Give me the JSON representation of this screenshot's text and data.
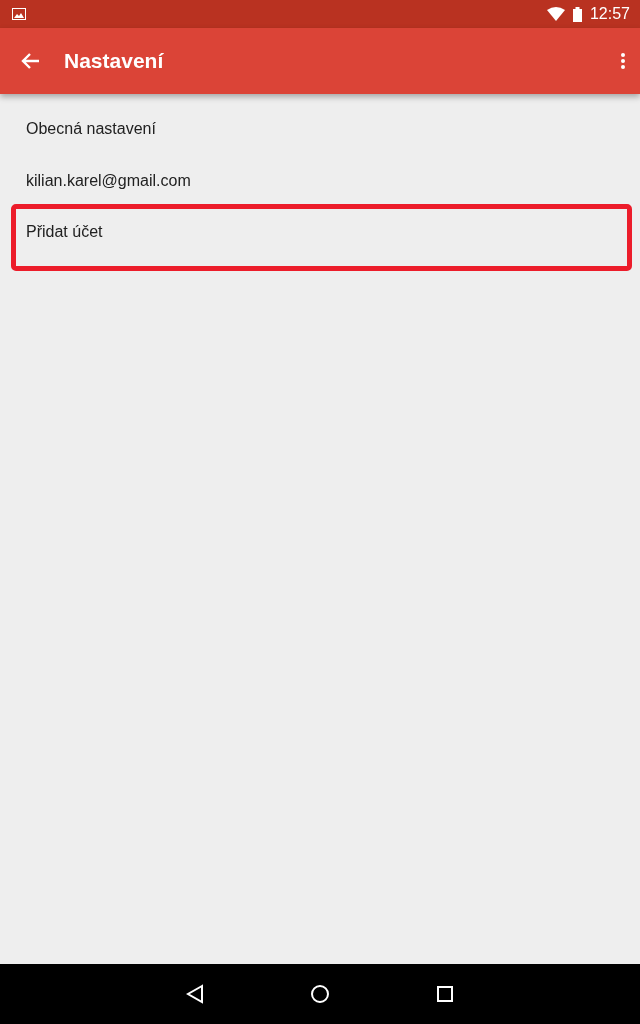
{
  "status_bar": {
    "time": "12:57"
  },
  "app_bar": {
    "title": "Nastavení"
  },
  "items": [
    {
      "label": "Obecná nastavení",
      "highlighted": false
    },
    {
      "label": "kilian.karel@gmail.com",
      "highlighted": false
    },
    {
      "label": "Přidat účet",
      "highlighted": true
    }
  ]
}
